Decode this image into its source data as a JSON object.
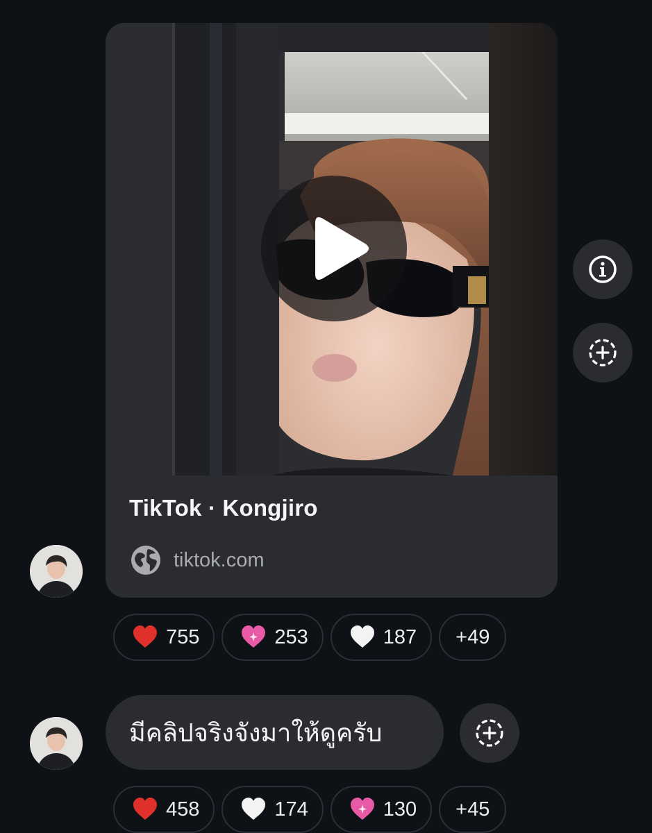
{
  "link_preview": {
    "title": "TikTok · Kongjiro",
    "domain": "tiktok.com",
    "media": "video-thumbnail",
    "play_icon": "play-icon",
    "domain_icon": "globe-icon"
  },
  "side_actions": {
    "info_icon": "info-icon",
    "add_reaction_icon": "add-reaction-icon"
  },
  "messages": [
    {
      "reactions": [
        {
          "emoji": "red-heart",
          "color": "#e0302b",
          "count": "755"
        },
        {
          "emoji": "sparkling-pink-heart",
          "color": "#e85aa6",
          "count": "253"
        },
        {
          "emoji": "white-heart",
          "color": "#f3f3f3",
          "count": "187"
        }
      ],
      "more_reactions": "+49"
    },
    {
      "text": "มีคลิปจริงจังมาให้ดูครับ",
      "reactions": [
        {
          "emoji": "red-heart",
          "color": "#e0302b",
          "count": "458"
        },
        {
          "emoji": "white-heart",
          "color": "#f3f3f3",
          "count": "174"
        },
        {
          "emoji": "sparkling-pink-heart",
          "color": "#e85aa6",
          "count": "130"
        }
      ],
      "more_reactions": "+45"
    }
  ],
  "colors": {
    "background": "#0e1116",
    "bubble": "#2a2c31",
    "secondary_text": "#a9abb0"
  }
}
